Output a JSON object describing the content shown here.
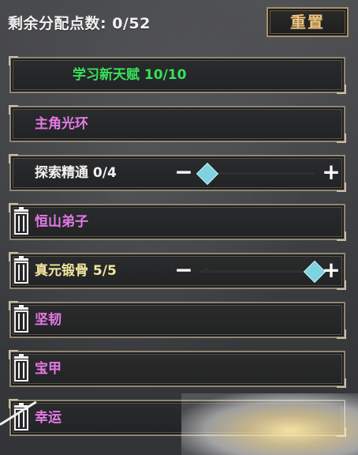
{
  "header": {
    "points_label": "剩余分配点数: 0/52",
    "reset_button": "重置"
  },
  "rows": [
    {
      "label": "学习新天赋 10/10",
      "color": "#38e05a",
      "deletable": false,
      "slider": false
    },
    {
      "label": "主角光环",
      "color": "#e57ae6",
      "deletable": false,
      "slider": false
    },
    {
      "label": "探索精通 0/4",
      "color": "#f2f2f2",
      "deletable": false,
      "slider": true,
      "slider_level": 0
    },
    {
      "label": "恒山弟子",
      "color": "#e57ae6",
      "deletable": true,
      "slider": false
    },
    {
      "label": "真元锻骨 5/5",
      "color": "#f4e7a0",
      "deletable": true,
      "slider": true,
      "slider_level": 1
    },
    {
      "label": "坚韧",
      "color": "#e57ae6",
      "deletable": true,
      "slider": false
    },
    {
      "label": "宝甲",
      "color": "#e57ae6",
      "deletable": true,
      "slider": false
    },
    {
      "label": "幸运",
      "color": "#e57ae6",
      "deletable": true,
      "slider": false
    }
  ],
  "icons": {
    "delete": "trash-icon",
    "decrease": "minus-icon",
    "increase": "plus-icon",
    "handle": "diamond-handle-icon"
  }
}
